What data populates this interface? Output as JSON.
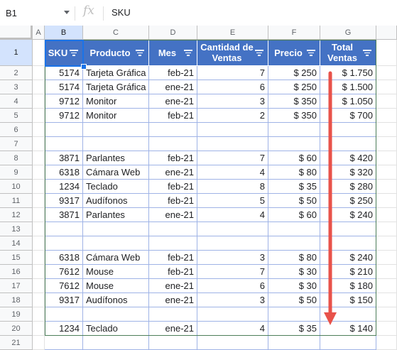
{
  "formula_bar": {
    "cell_ref": "B1",
    "fx_label": "fx",
    "content": "SKU"
  },
  "columns": [
    "A",
    "B",
    "C",
    "D",
    "E",
    "F",
    "G"
  ],
  "selected_column": "B",
  "selected_row": "1",
  "header": {
    "sku": "SKU",
    "producto": "Producto",
    "mes": "Mes",
    "cantidad": "Cantidad de Ventas",
    "precio": "Precio",
    "total": "Total Ventas"
  },
  "rows": [
    {
      "n": "1"
    },
    {
      "n": "2",
      "sku": "5174",
      "producto": "Tarjeta Gráfica",
      "mes": "feb-21",
      "cantidad": "7",
      "precio": "$ 250",
      "total": "$ 1.750"
    },
    {
      "n": "3",
      "sku": "5174",
      "producto": "Tarjeta Gráfica",
      "mes": "ene-21",
      "cantidad": "6",
      "precio": "$ 250",
      "total": "$ 1.500"
    },
    {
      "n": "4",
      "sku": "9712",
      "producto": "Monitor",
      "mes": "ene-21",
      "cantidad": "3",
      "precio": "$ 350",
      "total": "$ 1.050"
    },
    {
      "n": "5",
      "sku": "9712",
      "producto": "Monitor",
      "mes": "feb-21",
      "cantidad": "2",
      "precio": "$ 350",
      "total": "$ 700"
    },
    {
      "n": "6"
    },
    {
      "n": "7"
    },
    {
      "n": "8",
      "sku": "3871",
      "producto": "Parlantes",
      "mes": "feb-21",
      "cantidad": "7",
      "precio": "$ 60",
      "total": "$ 420"
    },
    {
      "n": "9",
      "sku": "6318",
      "producto": "Cámara Web",
      "mes": "ene-21",
      "cantidad": "4",
      "precio": "$ 80",
      "total": "$ 320"
    },
    {
      "n": "10",
      "sku": "1234",
      "producto": "Teclado",
      "mes": "feb-21",
      "cantidad": "8",
      "precio": "$ 35",
      "total": "$ 280"
    },
    {
      "n": "11",
      "sku": "9317",
      "producto": "Audífonos",
      "mes": "feb-21",
      "cantidad": "5",
      "precio": "$ 50",
      "total": "$ 250"
    },
    {
      "n": "12",
      "sku": "3871",
      "producto": "Parlantes",
      "mes": "ene-21",
      "cantidad": "4",
      "precio": "$ 60",
      "total": "$ 240"
    },
    {
      "n": "13"
    },
    {
      "n": "14"
    },
    {
      "n": "15",
      "sku": "6318",
      "producto": "Cámara Web",
      "mes": "feb-21",
      "cantidad": "3",
      "precio": "$ 80",
      "total": "$ 240"
    },
    {
      "n": "16",
      "sku": "7612",
      "producto": "Mouse",
      "mes": "feb-21",
      "cantidad": "7",
      "precio": "$ 30",
      "total": "$ 210"
    },
    {
      "n": "17",
      "sku": "7612",
      "producto": "Mouse",
      "mes": "ene-21",
      "cantidad": "6",
      "precio": "$ 30",
      "total": "$ 180"
    },
    {
      "n": "18",
      "sku": "9317",
      "producto": "Audífonos",
      "mes": "ene-21",
      "cantidad": "3",
      "precio": "$ 50",
      "total": "$ 150"
    },
    {
      "n": "19"
    },
    {
      "n": "20",
      "sku": "1234",
      "producto": "Teclado",
      "mes": "ene-21",
      "cantidad": "4",
      "precio": "$ 35",
      "total": "$ 140"
    },
    {
      "n": "21"
    }
  ],
  "colors": {
    "header_fill": "#4472c4",
    "selection": "#1a73e8",
    "annotation_arrow": "#e8524a",
    "table_frame": "#4d7e5a"
  },
  "annotation": {
    "icon": "sort-descending-arrow-icon"
  }
}
